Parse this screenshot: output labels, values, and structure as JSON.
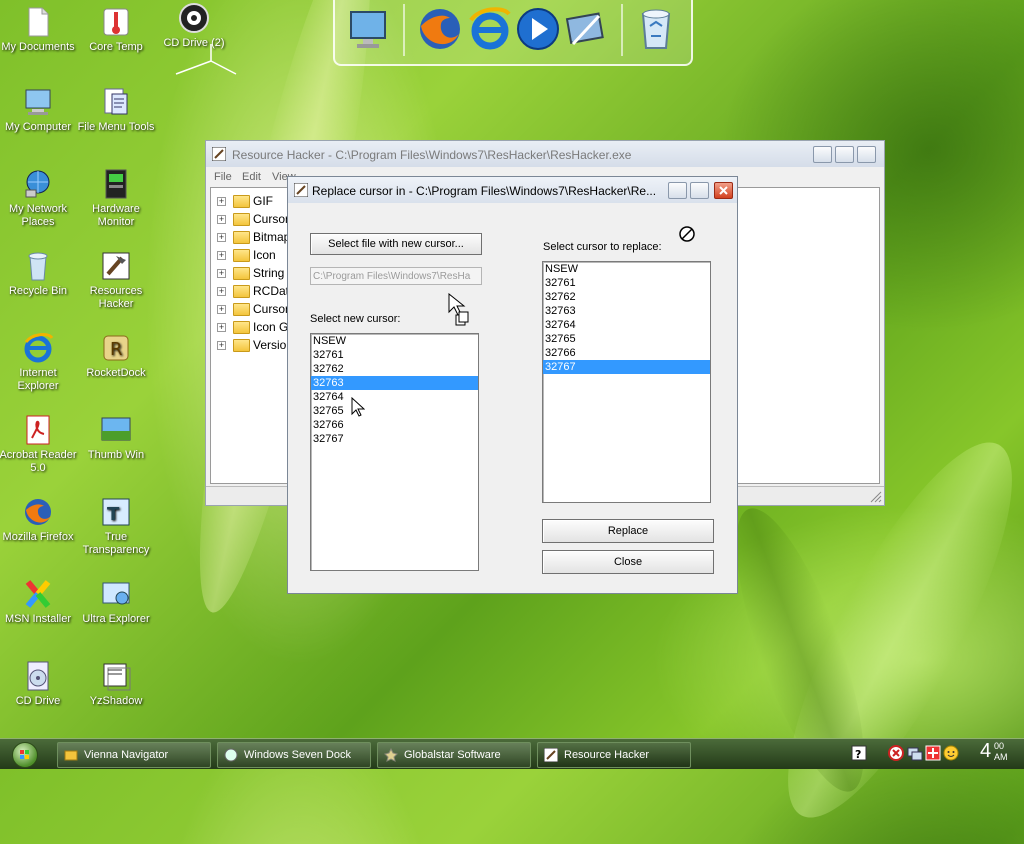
{
  "desktop": {
    "icons": [
      {
        "label": "My Documents",
        "icon": "document-icon"
      },
      {
        "label": "Core Temp",
        "icon": "thermometer-icon"
      },
      {
        "label": "CD Drive (2)",
        "icon": "cd-drive-icon"
      },
      {
        "label": "My Computer",
        "icon": "computer-icon"
      },
      {
        "label": "File Menu Tools",
        "icon": "file-tools-icon"
      },
      {
        "label": "My Network Places",
        "icon": "network-icon"
      },
      {
        "label": "Hardware Monitor",
        "icon": "hardware-monitor-icon"
      },
      {
        "label": "Recycle Bin",
        "icon": "recycle-bin-icon"
      },
      {
        "label": "Resources Hacker",
        "icon": "resource-hacker-icon"
      },
      {
        "label": "Internet Explorer",
        "icon": "internet-explorer-icon"
      },
      {
        "label": "RocketDock",
        "icon": "rocketdock-icon"
      },
      {
        "label": "Acrobat Reader 5.0",
        "icon": "acrobat-icon"
      },
      {
        "label": "Thumb Win",
        "icon": "thumbwin-icon"
      },
      {
        "label": "Mozilla Firefox",
        "icon": "firefox-icon"
      },
      {
        "label": "True Transparency",
        "icon": "true-transparency-icon"
      },
      {
        "label": "MSN Installer",
        "icon": "msn-icon"
      },
      {
        "label": "Ultra Explorer",
        "icon": "ultra-explorer-icon"
      },
      {
        "label": "CD Drive",
        "icon": "cd-drive-icon"
      },
      {
        "label": "YzShadow",
        "icon": "yzshadow-icon"
      }
    ]
  },
  "dock": {
    "items": [
      "monitor-icon",
      "firefox-icon",
      "internet-explorer-icon",
      "media-player-icon",
      "settings-icon",
      "recycle-bin-icon"
    ]
  },
  "main_window": {
    "title": "Resource Hacker  -  C:\\Program Files\\Windows7\\ResHacker\\ResHacker.exe",
    "menu": [
      "File",
      "Edit",
      "View"
    ],
    "tree": [
      {
        "label": "GIF"
      },
      {
        "label": "Cursor"
      },
      {
        "label": "Bitmap"
      },
      {
        "label": "Icon"
      },
      {
        "label": "String T"
      },
      {
        "label": "RCData"
      },
      {
        "label": "Cursor"
      },
      {
        "label": "Icon G"
      },
      {
        "label": "Versio"
      }
    ]
  },
  "dialog": {
    "title": "Replace cursor in - C:\\Program Files\\Windows7\\ResHacker\\Re...",
    "select_file_button": "Select file with new cursor...",
    "file_path": "C:\\Program Files\\Windows7\\ResHa",
    "new_cursor_label": "Select new cursor:",
    "new_cursor_list": [
      "NSEW",
      "32761",
      "32762",
      "32763",
      "32764",
      "32765",
      "32766",
      "32767"
    ],
    "new_cursor_selected": "32763",
    "replace_label": "Select cursor to replace:",
    "replace_list": [
      "NSEW",
      "32761",
      "32762",
      "32763",
      "32764",
      "32765",
      "32766",
      "32767"
    ],
    "replace_selected": "32767",
    "replace_button": "Replace",
    "close_button": "Close"
  },
  "taskbar": {
    "tasks": [
      {
        "label": "Vienna Navigator"
      },
      {
        "label": "Windows Seven Dock"
      },
      {
        "label": "Globalstar Software"
      },
      {
        "label": "Resource Hacker"
      }
    ],
    "clock_hour": "4",
    "clock_minute": "00",
    "clock_ampm": "AM"
  },
  "colors": {
    "selection": "#3399ff",
    "close_button": "#d2411f",
    "desktop_green": "#7fc02a"
  }
}
